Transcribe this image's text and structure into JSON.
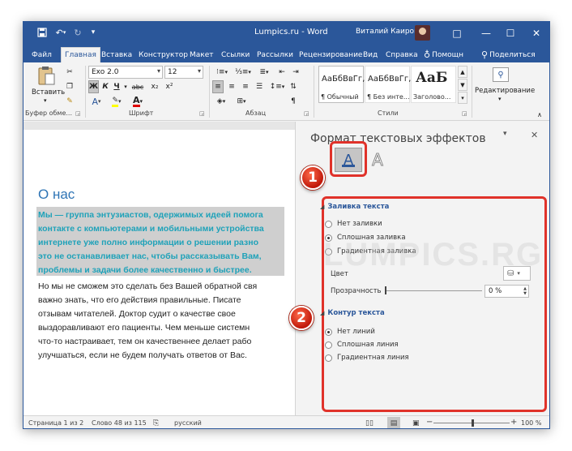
{
  "titlebar": {
    "title": "Lumpics.ru  -  Word",
    "user": "Виталий Каиров",
    "quick_access": {
      "save_icon": "save-icon",
      "undo_icon": "undo-icon",
      "redo_icon": "redo-icon",
      "customize_icon": "customize-icon"
    },
    "window_buttons": {
      "ribbon_display": "□",
      "minimize": "—",
      "maximize": "☐",
      "close": "✕"
    }
  },
  "tabs": [
    "Файл",
    "Главная",
    "Вставка",
    "Конструктор",
    "Макет",
    "Ссылки",
    "Рассылки",
    "Рецензирование",
    "Вид",
    "Справка",
    "Помощн",
    "Поделиться"
  ],
  "active_tab": "Главная",
  "ribbon": {
    "clipboard": {
      "paste_label": "Вставить",
      "group_label": "Буфер обме..."
    },
    "font": {
      "font_name": "Exo 2.0",
      "font_size": "12",
      "bold": "Ж",
      "italic": "К",
      "underline": "Ч",
      "strike": "abc",
      "subscript": "x₂",
      "superscript": "x²",
      "group_label": "Шрифт"
    },
    "paragraph": {
      "group_label": "Абзац"
    },
    "styles": {
      "items": [
        {
          "preview": "АаБбВвГг,",
          "name": "¶ Обычный"
        },
        {
          "preview": "АаБбВвГг,",
          "name": "¶ Без инте..."
        },
        {
          "preview": "АаБ",
          "name": "Заголово..."
        }
      ],
      "group_label": "Стили"
    },
    "editing": {
      "label": "Редактирование"
    }
  },
  "document": {
    "heading": "О нас",
    "para1_lines": [
      "Мы — группа энтузиастов, одержимых идеей помога",
      "контакте с компьютерами и мобильными устройства",
      "интернете уже полно информации о решении разно",
      "это не останавливает нас, чтобы рассказывать Вам,",
      "проблемы и задачи более качественно и быстрее."
    ],
    "para2_lines": [
      "Но мы не сможем это сделать без Вашей обратной свя",
      "важно знать, что его действия правильные. Писате",
      "отзывам читателей. Доктор судит о качестве свое",
      "выздоравливают его пациенты. Чем меньше системн",
      "что-то настраивает, тем он качественнее делает рабо",
      "улучшаться, если не будем получать ответов от Вас."
    ]
  },
  "pane": {
    "title": "Формат текстовых эффектов",
    "fill_section": "Заливка текста",
    "fill_options": [
      "Нет заливки",
      "Сплошная заливка",
      "Градиентная заливка"
    ],
    "fill_selected": 1,
    "color_label": "Цвет",
    "transparency_label": "Прозрачность",
    "transparency_value": "0 %",
    "outline_section": "Контур текста",
    "outline_options": [
      "Нет линий",
      "Сплошная линия",
      "Градиентная линия"
    ],
    "outline_selected": 0,
    "icons": {
      "fill_tab": "A",
      "effects_tab": "A"
    }
  },
  "callouts": [
    "1",
    "2"
  ],
  "statusbar": {
    "page": "Страница 1 из 2",
    "words": "Слово 48 из 115",
    "lang": "русский",
    "zoom": "100 %",
    "zoom_minus": "−",
    "zoom_plus": "+"
  },
  "watermark": "LUMPICS.RU",
  "colors": {
    "accent": "#2b579a",
    "highlight_text": "#1fa2b9",
    "heading": "#2e74b5",
    "callout": "#e0322a"
  }
}
